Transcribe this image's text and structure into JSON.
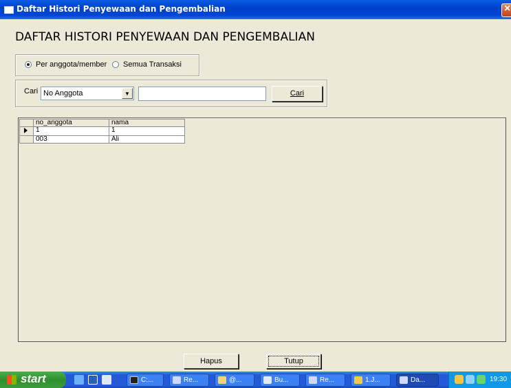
{
  "window": {
    "title": "Daftar Histori Penyewaan dan Pengembalian",
    "close_icon": "close-icon"
  },
  "heading": "DAFTAR HISTORI PENYEWAAN DAN PENGEMBALIAN",
  "filter_mode": {
    "options": [
      {
        "label": "Per anggota/member",
        "selected": true
      },
      {
        "label": "Semua Transaksi",
        "selected": false
      }
    ]
  },
  "search": {
    "label": "Cari",
    "field_selected": "No Anggota",
    "query_value": "",
    "button_label": "Cari"
  },
  "grid": {
    "columns": [
      "no_anggota",
      "nama"
    ],
    "rows": [
      {
        "no_anggota": "1",
        "nama": "1"
      },
      {
        "no_anggota": "003",
        "nama": "Ali"
      }
    ],
    "current_row": 0
  },
  "actions": {
    "hapus_label": "Hapus",
    "tutup_label": "Tutup"
  },
  "taskbar": {
    "start_label": "start",
    "tasks": [
      {
        "label": "C:...",
        "icon": "console-icon",
        "color": "#222222"
      },
      {
        "label": "Re...",
        "icon": "app-icon",
        "color": "#d0d8ff"
      },
      {
        "label": "@...",
        "icon": "folder-icon",
        "color": "#f2d27a"
      },
      {
        "label": "Bu...",
        "icon": "window-icon",
        "color": "#dfe9ff"
      },
      {
        "label": "Re...",
        "icon": "app-icon",
        "color": "#d0d8ff"
      },
      {
        "label": "1.J...",
        "icon": "document-icon",
        "color": "#f2c94c"
      },
      {
        "label": "Da...",
        "icon": "app-icon",
        "color": "#d0d8ff"
      }
    ],
    "clock": "19:30"
  }
}
